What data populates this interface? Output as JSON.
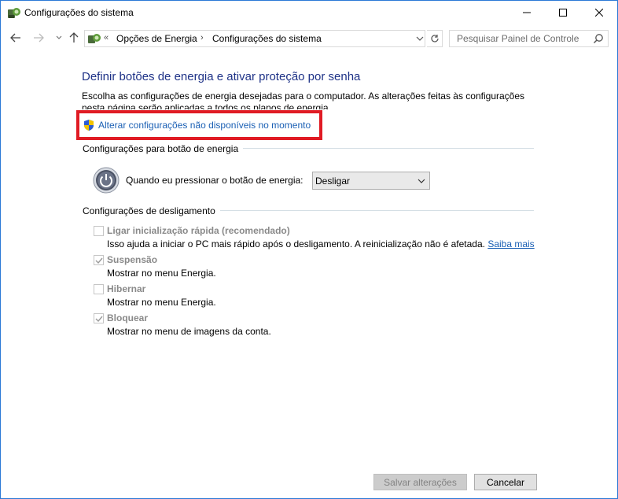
{
  "window": {
    "title": "Configurações do sistema"
  },
  "nav": {
    "breadcrumb_overflow": "«",
    "crumbs": [
      "Opções de Energia",
      "Configurações do sistema"
    ],
    "separator": "›",
    "search_placeholder": "Pesquisar Painel de Controle"
  },
  "main": {
    "heading": "Definir botões de energia e ativar proteção por senha",
    "description": "Escolha as configurações de energia desejadas para o computador. As alterações feitas às configurações nesta página serão aplicadas a todos os planos de energia.",
    "admin_link": "Alterar configurações não disponíveis no momento",
    "power_section": {
      "label": "Configurações para botão de energia",
      "power_button_label": "Quando eu pressionar o botão de energia:",
      "power_button_value": "Desligar"
    },
    "shutdown_section": {
      "label": "Configurações de desligamento",
      "options": [
        {
          "label": "Ligar inicialização rápida (recomendado)",
          "checked": false,
          "description": "Isso ajuda a iniciar o PC mais rápido após o desligamento. A reinicialização não é afetada.",
          "link": "Saiba mais"
        },
        {
          "label": "Suspensão",
          "checked": true,
          "description": "Mostrar no menu Energia."
        },
        {
          "label": "Hibernar",
          "checked": false,
          "description": "Mostrar no menu Energia."
        },
        {
          "label": "Bloquear",
          "checked": true,
          "description": "Mostrar no menu de imagens da conta."
        }
      ]
    }
  },
  "footer": {
    "save_label": "Salvar alterações",
    "cancel_label": "Cancelar"
  },
  "colors": {
    "heading": "#1e3287",
    "link": "#1a5fb4",
    "highlight": "#e01b24",
    "disabled_text": "#8a8a8a"
  }
}
